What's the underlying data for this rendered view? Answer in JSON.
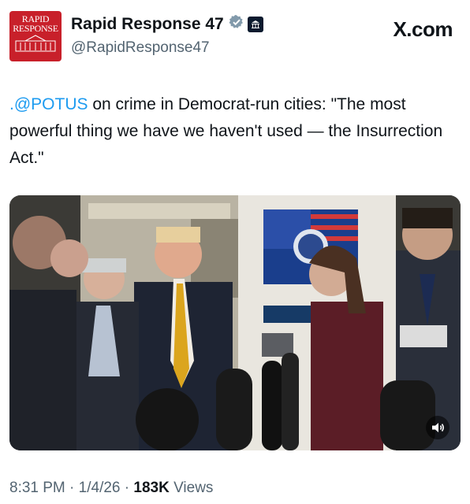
{
  "author": {
    "avatar_text": "RAPID\nRESPONSE",
    "display_name": "Rapid Response 47",
    "handle": "@RapidResponse47"
  },
  "source": "X.com",
  "tweet": {
    "mention": ".@POTUS",
    "text": " on crime in Democrat-run cities: \"The most powerful thing we have we haven't used — the Insurrection Act.\""
  },
  "meta": {
    "time": "8:31 PM",
    "sep1": " · ",
    "date": "1/4/26",
    "sep2": " · ",
    "views_count": "183K",
    "views_label": " Views"
  },
  "colors": {
    "accent": "#1d9bf0",
    "avatar_red": "#c8202a",
    "secondary_text": "#536471"
  },
  "icons": {
    "verified": "verified-badge-icon",
    "affiliation": "white-house-affiliate-icon",
    "mute": "speaker-icon"
  }
}
